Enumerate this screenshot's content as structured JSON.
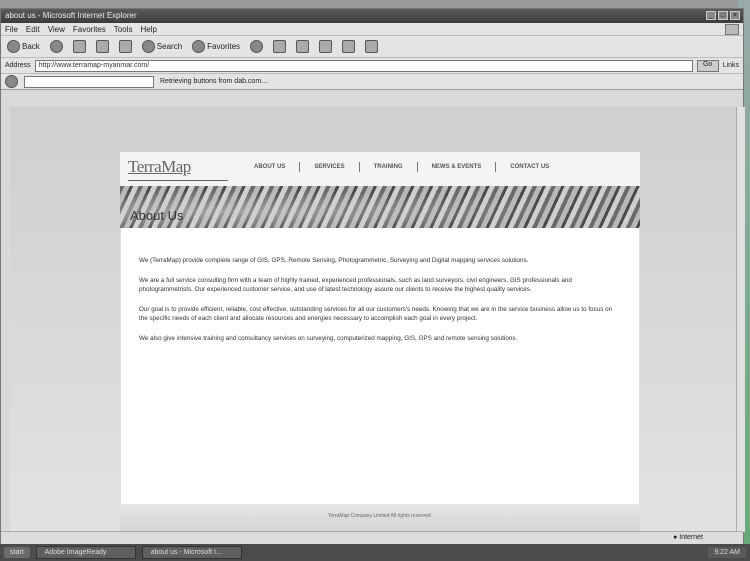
{
  "window": {
    "title": "about us - Microsoft Internet Explorer"
  },
  "menu": [
    "File",
    "Edit",
    "View",
    "Favorites",
    "Tools",
    "Help"
  ],
  "toolbar": {
    "back_label": "Back",
    "search_label": "Search",
    "favorites_label": "Favorites"
  },
  "address": {
    "label": "Address",
    "url": "http://www.terramap-myanmar.com/",
    "go_label": "Go",
    "links_label": "Links"
  },
  "links_bar": {
    "status_text": "Retrieving buttons from dab.com...."
  },
  "site": {
    "logo": "TerraMap",
    "nav": [
      "ABOUT US",
      "SERVICES",
      "TRAINING",
      "NEWS & EVENTS",
      "CONTACT US"
    ],
    "banner_title": "About Us",
    "paragraphs": [
      "We (TerraMap) provide complete range of GIS, GPS, Remote Sensing, Photogrammetric, Surveying and Digital mapping services solutions.",
      "We are a full service consulting firm with a team of highly trained, experienced professionals, such as land surveyors, civil engineers, GIS professionals and photogrammetrists. Our experienced customer service, and use of latest technology assure our clients to receive the highest quality services.",
      "Our goal is to provide efficient, reliable, cost effective, outstanding services for all our customers's needs. Knowing that we are in the service business allow us to focus on the specific needs of each client and allocate resources and energies necessary to accomplish each goal in every project.",
      "We also give intensive training and consultancy services on surveying, computerized mapping, GIS, GPS and remote sensing solutions."
    ],
    "footer": "TerraMap Company Limited All rights reserved."
  },
  "status": {
    "zone": "Internet"
  },
  "taskbar": {
    "start": "start",
    "tasks": [
      "Adobe ImageReady",
      "about us - Microsoft I..."
    ],
    "clock": "9:22 AM"
  }
}
